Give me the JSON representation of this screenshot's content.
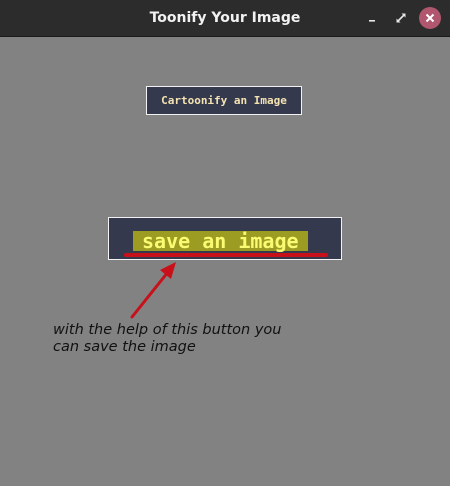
{
  "window": {
    "title": "Toonify Your Image",
    "controls": {
      "minimize_icon": "minimize-icon",
      "maximize_icon": "maximize-icon",
      "close_icon": "close-icon",
      "close_color": "#b0566f"
    }
  },
  "main": {
    "cartoonify_button": "Cartoonify an Image",
    "save_button": "save an image"
  },
  "annotation": {
    "text": "with the help of this button you can save the image",
    "color": "#c8101a"
  },
  "colors": {
    "background": "#828282",
    "titlebar": "#2c2c2c",
    "button_bg": "#34394d",
    "cartoonify_text": "#f4e3b1",
    "save_highlight": "#9c9c22",
    "save_text": "#fbfb73"
  }
}
